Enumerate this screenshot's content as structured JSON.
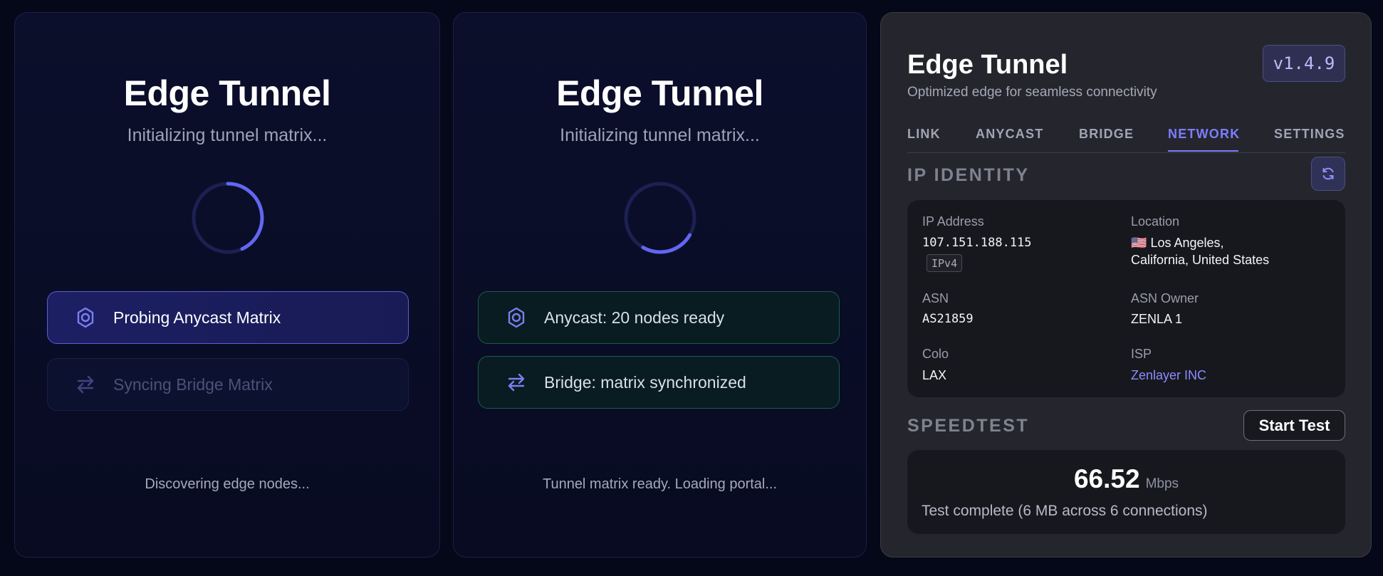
{
  "loader_a": {
    "title": "Edge Tunnel",
    "subtitle": "Initializing tunnel matrix...",
    "steps": [
      {
        "label": "Probing Anycast Matrix",
        "state": "active",
        "icon": "gear-chip-icon"
      },
      {
        "label": "Syncing Bridge Matrix",
        "state": "pending",
        "icon": "swap-arrows-icon"
      }
    ],
    "footer": "Discovering edge nodes..."
  },
  "loader_b": {
    "title": "Edge Tunnel",
    "subtitle": "Initializing tunnel matrix...",
    "steps": [
      {
        "label": "Anycast: 20 nodes ready",
        "state": "done",
        "icon": "gear-chip-icon"
      },
      {
        "label": "Bridge: matrix synchronized",
        "state": "done",
        "icon": "swap-arrows-icon"
      }
    ],
    "footer": "Tunnel matrix ready. Loading portal..."
  },
  "portal": {
    "title": "Edge Tunnel",
    "subtitle": "Optimized edge for seamless connectivity",
    "version": "v1.4.9",
    "tabs": [
      {
        "label": "LINK",
        "active": false
      },
      {
        "label": "ANYCAST",
        "active": false
      },
      {
        "label": "BRIDGE",
        "active": false
      },
      {
        "label": "NETWORK",
        "active": true
      },
      {
        "label": "SETTINGS",
        "active": false
      }
    ],
    "ip_identity": {
      "section_title": "IP IDENTITY",
      "refresh_icon": "refresh-icon",
      "ip_label": "IP Address",
      "ip_value": "107.151.188.115",
      "ip_type": "IPv4",
      "location_label": "Location",
      "location_flag": "🇺🇸",
      "location_line1": "Los Angeles,",
      "location_line2": "California, United States",
      "asn_label": "ASN",
      "asn_value": "AS21859",
      "asn_owner_label": "ASN Owner",
      "asn_owner_value": "ZENLA 1",
      "colo_label": "Colo",
      "colo_value": "LAX",
      "isp_label": "ISP",
      "isp_value": "Zenlayer INC"
    },
    "speedtest": {
      "section_title": "SPEEDTEST",
      "start_label": "Start Test",
      "value": "66.52",
      "unit": "Mbps",
      "status": "Test complete (6 MB across 6 connections)"
    }
  },
  "colors": {
    "background": "#050818",
    "accent": "#7d7dff",
    "spinner_arc": "#6366f1",
    "done_border": "#1f5a4b"
  }
}
